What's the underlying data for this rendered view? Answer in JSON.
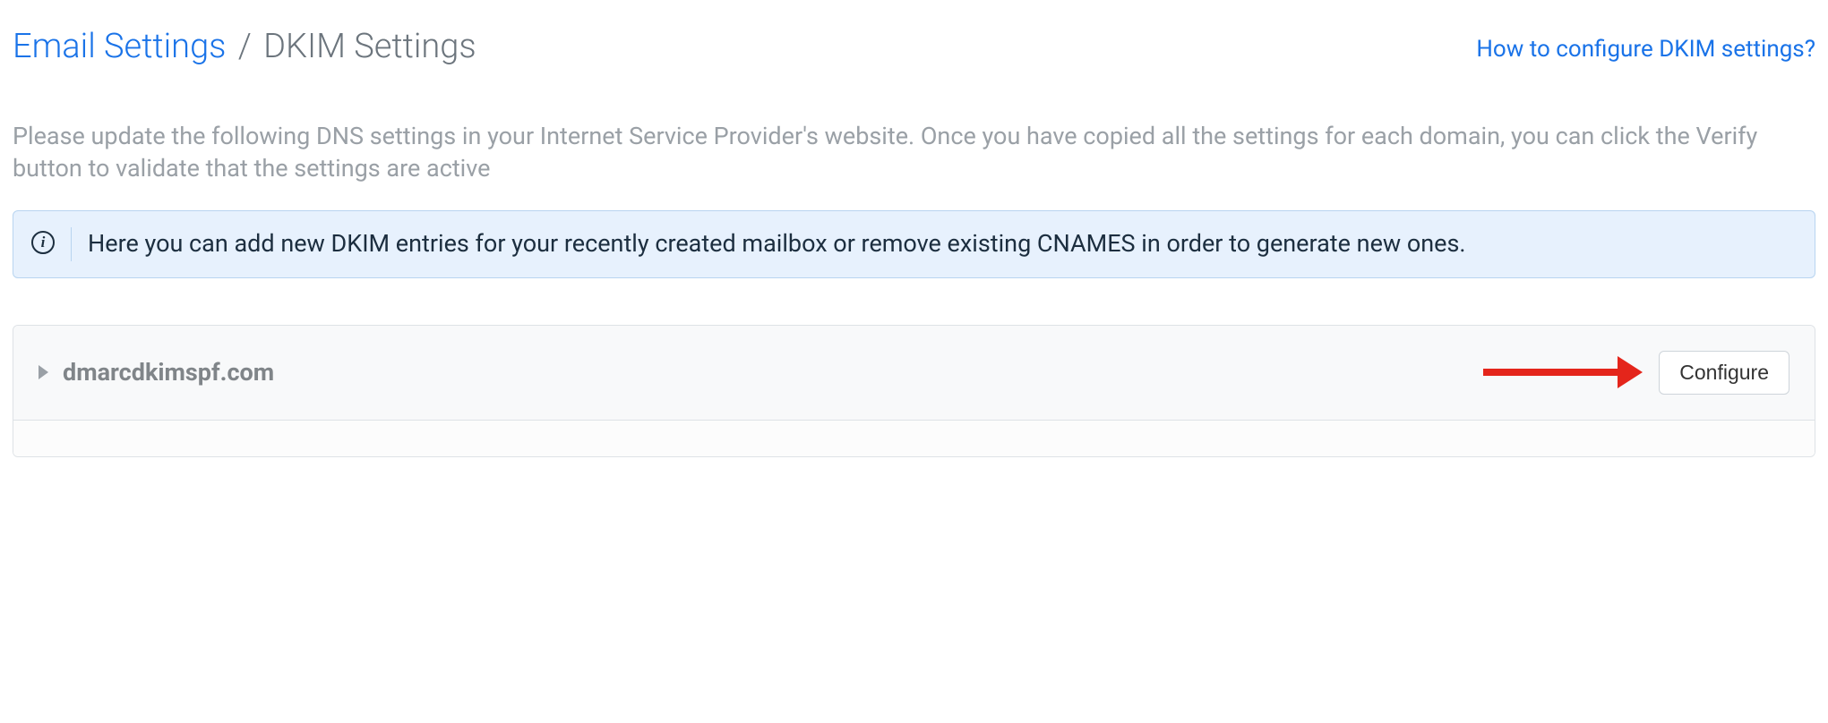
{
  "breadcrumb": {
    "parent": "Email Settings",
    "separator": "/",
    "current": "DKIM Settings"
  },
  "help_link": "How to configure DKIM settings?",
  "description": "Please update the following DNS settings in your Internet Service Provider's website. Once you have copied all the settings for each domain, you can click the Verify button to validate that the settings are active",
  "info_banner": {
    "icon_name": "info-icon",
    "text": "Here you can add new DKIM entries for your recently created mailbox or remove existing CNAMES in order to generate new ones."
  },
  "domains": [
    {
      "name": "dmarcdkimspf.com",
      "action_label": "Configure"
    }
  ],
  "annotation": {
    "type": "arrow",
    "color": "#e4251b"
  }
}
